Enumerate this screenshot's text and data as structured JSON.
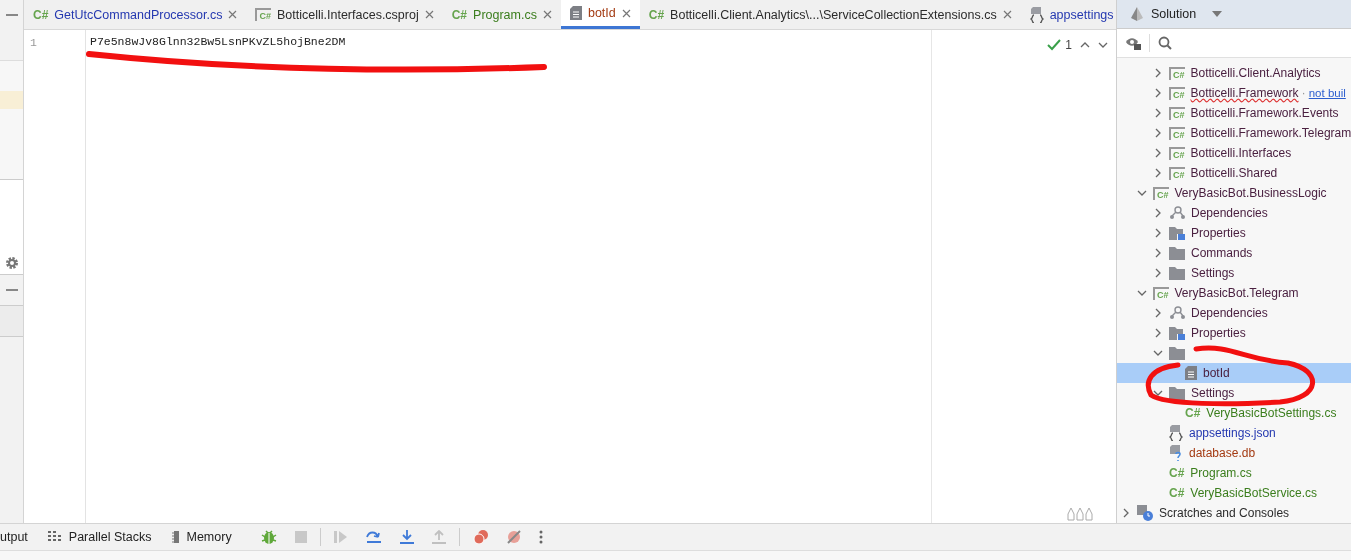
{
  "tabs": [
    {
      "label": "GetUtcCommandProcessor.cs",
      "type_label": "C#",
      "kind": "cs",
      "color": "#2438b0",
      "selected": false
    },
    {
      "label": "Botticelli.Interfaces.csproj",
      "type_label": "C#",
      "kind": "project",
      "color": "#2b2b2b",
      "selected": false
    },
    {
      "label": "Program.cs",
      "type_label": "C#",
      "kind": "cs",
      "color": "#3a7d1c",
      "selected": false
    },
    {
      "label": "botId",
      "kind": "text",
      "color": "#a33a12",
      "selected": true
    },
    {
      "label": "Botticelli.Client.Analytics\\...\\ServiceCollectionExtensions.cs",
      "type_label": "C#",
      "kind": "cs",
      "color": "#2b2b2b",
      "selected": false
    },
    {
      "label": "appsettings",
      "kind": "json",
      "color": "#2438b0",
      "selected": false
    }
  ],
  "editor": {
    "line_number": "1",
    "code": "P7e5n8wJv8Glnn32Bw5LsnPKvZL5hojBne2DM",
    "inspection_count": "1"
  },
  "solution_panel": {
    "title": "Solution"
  },
  "tree": [
    {
      "kind": "offscreen",
      "children": [
        {
          "kind": "offscreen",
          "children": [
            {
              "label": "Botticelli.Client.Analytics",
              "kind": "project",
              "type_label": "C#",
              "color": "#4a2040",
              "expanded": false,
              "selected": false
            },
            {
              "label": "Botticelli.Framework",
              "kind": "project",
              "type_label": "C#",
              "color": "#4a2040",
              "expanded": false,
              "selected": false,
              "error": true,
              "separator": "·",
              "note": "not buil"
            },
            {
              "label": "Botticelli.Framework.Events",
              "kind": "project",
              "type_label": "C#",
              "color": "#4a2040",
              "expanded": false,
              "selected": false
            },
            {
              "label": "Botticelli.Framework.Telegram",
              "kind": "project",
              "type_label": "C#",
              "color": "#4a2040",
              "expanded": false,
              "selected": false
            },
            {
              "label": "Botticelli.Interfaces",
              "kind": "project",
              "type_label": "C#",
              "color": "#4a2040",
              "expanded": false,
              "selected": false
            },
            {
              "label": "Botticelli.Shared",
              "kind": "project",
              "type_label": "C#",
              "color": "#4a2040",
              "expanded": false,
              "selected": false
            }
          ]
        },
        {
          "label": "VeryBasicBot.BusinessLogic",
          "kind": "project",
          "type_label": "C#",
          "color": "#4a2040",
          "expanded": true,
          "selected": false,
          "children": [
            {
              "label": "Dependencies",
              "kind": "dependencies",
              "color": "#4a2040",
              "expanded": false,
              "selected": false
            },
            {
              "label": "Properties",
              "kind": "properties",
              "color": "#4a2040",
              "expanded": false,
              "selected": false
            },
            {
              "label": "Commands",
              "kind": "folder",
              "color": "#4a2040",
              "expanded": false,
              "selected": false
            },
            {
              "label": "Settings",
              "kind": "folder",
              "color": "#4a2040",
              "expanded": false,
              "selected": false
            }
          ]
        },
        {
          "label": "VeryBasicBot.Telegram",
          "kind": "project",
          "type_label": "C#",
          "color": "#4a2040",
          "expanded": true,
          "selected": false,
          "children": [
            {
              "label": "Dependencies",
              "kind": "dependencies",
              "color": "#4a2040",
              "expanded": false,
              "selected": false
            },
            {
              "label": "Properties",
              "kind": "properties",
              "color": "#4a2040",
              "expanded": false,
              "selected": false
            },
            {
              "kind": "folder",
              "expanded": true,
              "selected": false,
              "children": [
                {
                  "label": "botId",
                  "kind": "text-file",
                  "color": "#4a2040",
                  "selected": true
                }
              ]
            },
            {
              "label": "Settings",
              "kind": "folder",
              "color": "#4a2040",
              "expanded": true,
              "selected": false,
              "children": [
                {
                  "label": "VeryBasicBotSettings.cs",
                  "kind": "cs-file",
                  "type_label": "C#",
                  "color": "#3a7d1c",
                  "selected": false
                }
              ]
            },
            {
              "label": "appsettings.json",
              "kind": "json-file",
              "color": "#2438b0",
              "selected": false
            },
            {
              "label": "database.db",
              "kind": "db-file",
              "color": "#a33a12",
              "selected": false
            },
            {
              "label": "Program.cs",
              "kind": "cs-file",
              "type_label": "C#",
              "color": "#3a7d1c",
              "selected": false
            },
            {
              "label": "VeryBasicBotService.cs",
              "kind": "cs-file",
              "type_label": "C#",
              "color": "#3a7d1c",
              "selected": false
            }
          ]
        }
      ]
    },
    {
      "label": "Scratches and Consoles",
      "kind": "scratches",
      "color": "#2b2b2b",
      "expanded": false,
      "selected": false
    }
  ],
  "bottom_toolbar": {
    "tabs": [
      {
        "label": "utput",
        "kind": "output"
      },
      {
        "label": "Parallel Stacks",
        "kind": "stacks"
      },
      {
        "label": "Memory",
        "kind": "memory"
      }
    ]
  }
}
